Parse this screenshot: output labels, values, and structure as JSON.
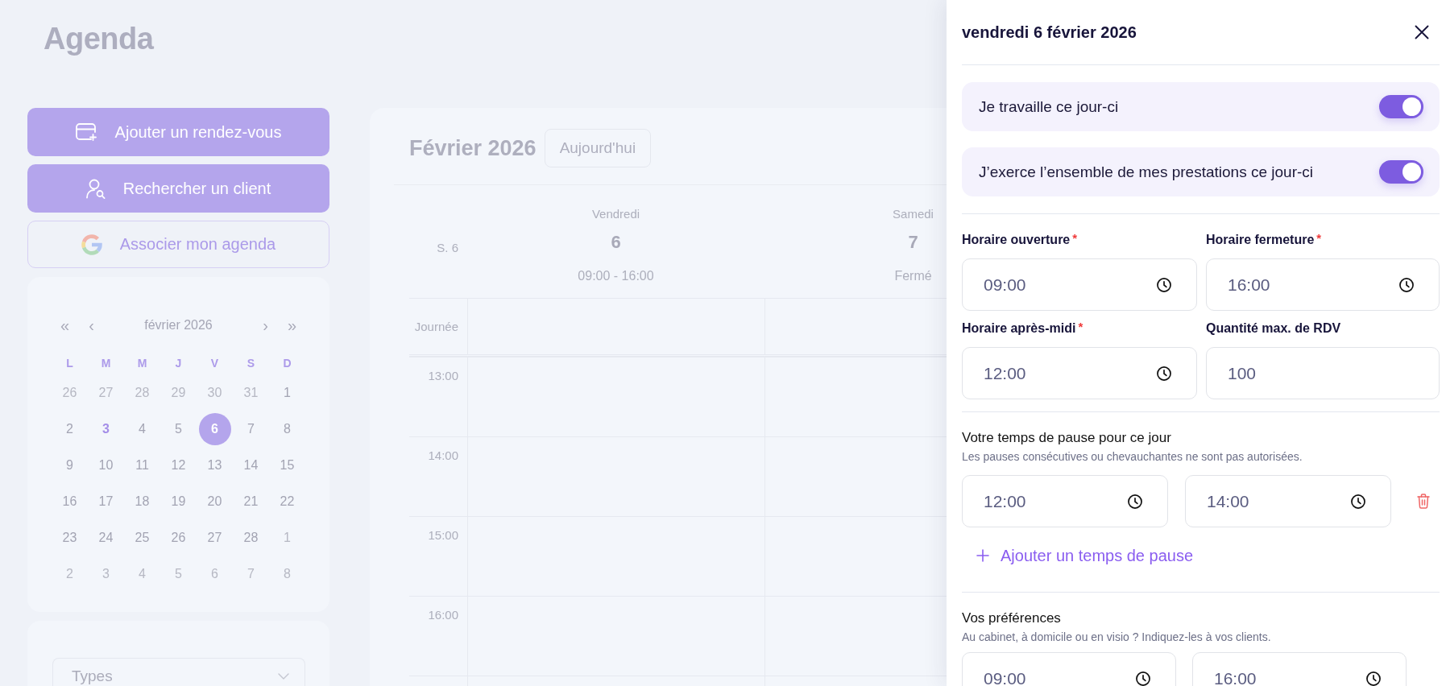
{
  "page_title": "Agenda",
  "actions": [
    {
      "label": "Ajouter un rendez-vous",
      "kind": "add"
    },
    {
      "label": "Rechercher un client",
      "kind": "search"
    },
    {
      "label": "Associer mon agenda",
      "kind": "link"
    }
  ],
  "mini_calendar": {
    "month": "février 2026",
    "nav_back": [
      "«",
      "‹"
    ],
    "nav_forward": [
      "›",
      "»"
    ],
    "weekdays": [
      "L",
      "M",
      "M",
      "J",
      "V",
      "S",
      "D"
    ],
    "weeks": [
      [
        {
          "day": "26",
          "outside": true,
          "today": false,
          "selected": false
        },
        {
          "day": "27",
          "outside": true,
          "today": false,
          "selected": false
        },
        {
          "day": "28",
          "outside": true,
          "today": false,
          "selected": false
        },
        {
          "day": "29",
          "outside": true,
          "today": false,
          "selected": false
        },
        {
          "day": "30",
          "outside": true,
          "today": false,
          "selected": false
        },
        {
          "day": "31",
          "outside": true,
          "today": false,
          "selected": false
        },
        {
          "day": "1",
          "outside": false,
          "today": false,
          "selected": false
        }
      ],
      [
        {
          "day": "2",
          "outside": false,
          "today": false,
          "selected": false
        },
        {
          "day": "3",
          "outside": false,
          "today": true,
          "selected": false
        },
        {
          "day": "4",
          "outside": false,
          "today": false,
          "selected": false
        },
        {
          "day": "5",
          "outside": false,
          "today": false,
          "selected": false
        },
        {
          "day": "6",
          "outside": false,
          "today": false,
          "selected": true
        },
        {
          "day": "7",
          "outside": false,
          "today": false,
          "selected": false
        },
        {
          "day": "8",
          "outside": false,
          "today": false,
          "selected": false
        }
      ],
      [
        {
          "day": "9",
          "outside": false,
          "today": false,
          "selected": false
        },
        {
          "day": "10",
          "outside": false,
          "today": false,
          "selected": false
        },
        {
          "day": "11",
          "outside": false,
          "today": false,
          "selected": false
        },
        {
          "day": "12",
          "outside": false,
          "today": false,
          "selected": false
        },
        {
          "day": "13",
          "outside": false,
          "today": false,
          "selected": false
        },
        {
          "day": "14",
          "outside": false,
          "today": false,
          "selected": false
        },
        {
          "day": "15",
          "outside": false,
          "today": false,
          "selected": false
        }
      ],
      [
        {
          "day": "16",
          "outside": false,
          "today": false,
          "selected": false
        },
        {
          "day": "17",
          "outside": false,
          "today": false,
          "selected": false
        },
        {
          "day": "18",
          "outside": false,
          "today": false,
          "selected": false
        },
        {
          "day": "19",
          "outside": false,
          "today": false,
          "selected": false
        },
        {
          "day": "20",
          "outside": false,
          "today": false,
          "selected": false
        },
        {
          "day": "21",
          "outside": false,
          "today": false,
          "selected": false
        },
        {
          "day": "22",
          "outside": false,
          "today": false,
          "selected": false
        }
      ],
      [
        {
          "day": "23",
          "outside": false,
          "today": false,
          "selected": false
        },
        {
          "day": "24",
          "outside": false,
          "today": false,
          "selected": false
        },
        {
          "day": "25",
          "outside": false,
          "today": false,
          "selected": false
        },
        {
          "day": "26",
          "outside": false,
          "today": false,
          "selected": false
        },
        {
          "day": "27",
          "outside": false,
          "today": false,
          "selected": false
        },
        {
          "day": "28",
          "outside": false,
          "today": false,
          "selected": false
        },
        {
          "day": "1",
          "outside": true,
          "today": false,
          "selected": false
        }
      ],
      [
        {
          "day": "2",
          "outside": true,
          "today": false,
          "selected": false
        },
        {
          "day": "3",
          "outside": true,
          "today": false,
          "selected": false
        },
        {
          "day": "4",
          "outside": true,
          "today": false,
          "selected": false
        },
        {
          "day": "5",
          "outside": true,
          "today": false,
          "selected": false
        },
        {
          "day": "6",
          "outside": true,
          "today": false,
          "selected": false
        },
        {
          "day": "7",
          "outside": true,
          "today": false,
          "selected": false
        },
        {
          "day": "8",
          "outside": true,
          "today": false,
          "selected": false
        }
      ]
    ]
  },
  "types_filter": {
    "placeholder": "Types"
  },
  "calendar": {
    "title": "Février 2026",
    "today_button": "Aujourd'hui",
    "week_label": "S. 6",
    "days": [
      {
        "weekday": "Vendredi",
        "date": "6",
        "hours": "09:00 - 16:00"
      },
      {
        "weekday": "Samedi",
        "date": "7",
        "hours": "Fermé"
      }
    ],
    "all_day_label": "Journée",
    "time_slots": [
      "13:00",
      "14:00",
      "15:00",
      "16:00"
    ]
  },
  "day_panel": {
    "title": "vendredi 6 février 2026",
    "toggles": [
      {
        "label": "Je travaille ce jour-ci",
        "on": true
      },
      {
        "label": "J’exerce l’ensemble de mes prestations ce jour-ci",
        "on": true
      }
    ],
    "required_mark": "*",
    "fields": [
      {
        "label": "Horaire ouverture",
        "required": true,
        "value": "09:00",
        "kind": "time"
      },
      {
        "label": "Horaire fermeture",
        "required": true,
        "value": "16:00",
        "kind": "time"
      },
      {
        "label": "Horaire après-midi",
        "required": true,
        "value": "12:00",
        "kind": "time"
      },
      {
        "label": "Quantité max. de RDV",
        "required": false,
        "value": "100",
        "kind": "number"
      }
    ],
    "breaks": {
      "title": "Votre temps de pause pour ce jour",
      "hint": "Les pauses consécutives ou chevauchantes ne sont pas autorisées.",
      "items": [
        {
          "start": "12:00",
          "end": "14:00"
        }
      ],
      "add_button": "Ajouter un temps de pause"
    },
    "preferences": {
      "title": "Vos préférences",
      "hint": "Au cabinet, à domicile ou en visio ? Indiquez-les à vos clients.",
      "times": [
        {
          "value": "09:00"
        },
        {
          "value": "16:00"
        }
      ]
    }
  }
}
